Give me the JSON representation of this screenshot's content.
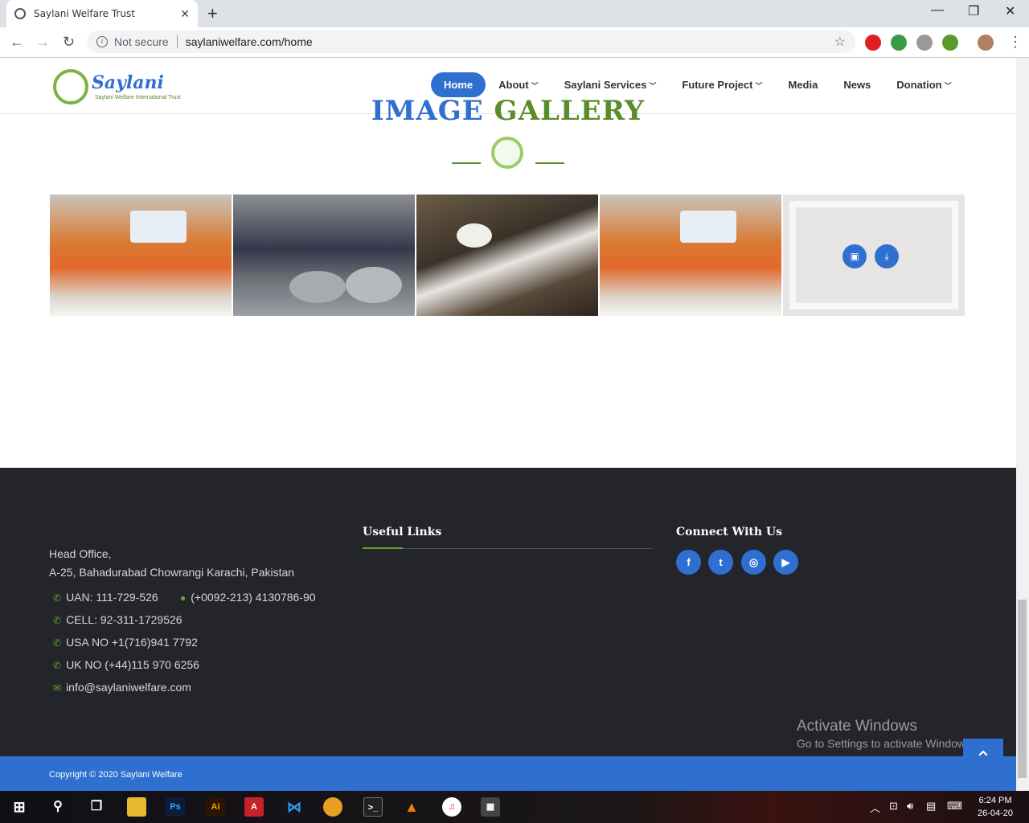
{
  "browser": {
    "tab_title": "Saylani Welfare Trust",
    "tab_close": "✕",
    "new_tab": "+",
    "security": "Not secure",
    "url": "saylaniwelfare.com/home",
    "win_min": "—",
    "win_max": "❐",
    "win_close": "✕"
  },
  "header": {
    "logo_text": "Saylani",
    "logo_sub": "Saylani Welfare International Trust",
    "nav": [
      {
        "label": "Home"
      },
      {
        "label": "About"
      },
      {
        "label": "Saylani Services"
      },
      {
        "label": "Future Project"
      },
      {
        "label": "Media"
      },
      {
        "label": "News"
      },
      {
        "label": "Donation"
      }
    ]
  },
  "gallery": {
    "title_a": "IMAGE",
    "title_b": "GALLERY"
  },
  "footer": {
    "office_line1": "Head Office,",
    "office_line2": "A-25, Bahadurabad Chowrangi Karachi, Pakistan",
    "uan": "UAN: 111-729-526",
    "phone": "(+0092-213) 4130786-90",
    "cell": "CELL: 92-311-1729526",
    "usa": "USA NO +1(716)941 7792",
    "uk": "UK NO (+44)115 970 6256",
    "email": "info@saylaniwelfare.com",
    "useful_links": "Useful Links",
    "connect": "Connect With Us",
    "copyright": "Copyright © 2020 Saylani Welfare"
  },
  "watermark": {
    "line1": "Activate Windows",
    "line2": "Go to Settings to activate Windows."
  },
  "taskbar": {
    "time": "6:24 PM",
    "date": "26-04-20"
  },
  "colors": {
    "brand_blue": "#2e6fd0",
    "brand_green": "#5a8c2a",
    "footer_bg": "#23252b"
  }
}
